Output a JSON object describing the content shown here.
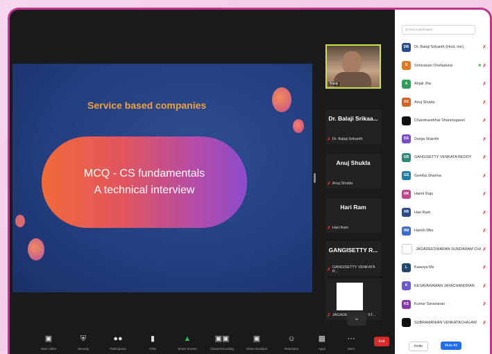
{
  "slide": {
    "title": "Service based companies",
    "line1": "MCQ - CS fundamentals",
    "line2": "A technical interview"
  },
  "thumbnails": [
    {
      "name": "Dr. Balaji Srikaa...",
      "sub": "Dr. Balaji Srikanth"
    },
    {
      "name": "Anuj Shukla",
      "sub": "Anuj Shukla"
    },
    {
      "name": "Hari Ram",
      "sub": "Hari Ram"
    },
    {
      "name": "GANGISETTY R...",
      "sub": "GANGISETTY VENKATA R..."
    },
    {
      "name": "",
      "sub": "JAGADEESWARAN ST..."
    }
  ],
  "video_label": "Balaji",
  "toolbar": {
    "items": [
      {
        "label": "Start Video",
        "icon": "video-off-icon"
      },
      {
        "label": "Security",
        "icon": "shield-icon"
      },
      {
        "label": "Participants",
        "icon": "participants-icon"
      },
      {
        "label": "Chat",
        "icon": "chat-icon"
      },
      {
        "label": "Share Screen",
        "icon": "share-screen-icon"
      },
      {
        "label": "Cloud Recording",
        "icon": "record-icon"
      },
      {
        "label": "Share Duration",
        "icon": "timer-icon"
      },
      {
        "label": "Reactions",
        "icon": "reactions-icon"
      },
      {
        "label": "Apps",
        "icon": "apps-icon"
      },
      {
        "label": "More",
        "icon": "more-icon"
      }
    ],
    "end_label": "End"
  },
  "panel": {
    "search_placeholder": "Q Find a participant",
    "participants": [
      {
        "initials": "DB",
        "name": "Dr. Balaji Srikanth (Host, me)",
        "color": "#2b4a8e"
      },
      {
        "initials": "S",
        "name": "Srinivasan Chelladurai",
        "color": "#e07a1e"
      },
      {
        "initials": "A",
        "name": "Anjali Jha",
        "color": "#2e9e5b"
      },
      {
        "initials": "AS",
        "name": "Anuj Shukla",
        "color": "#d0641e"
      },
      {
        "initials": "",
        "name": "Chandrasekhar Shanmugavel",
        "color": "#111111"
      },
      {
        "initials": "DS",
        "name": "Durga Shanthi",
        "color": "#7a4ec2"
      },
      {
        "initials": "GR",
        "name": "GANGISETTY VENKATA REDDY",
        "color": "#2a8a7a"
      },
      {
        "initials": "GS",
        "name": "Geetha Sharma",
        "color": "#1f7fa8"
      },
      {
        "initials": "HR",
        "name": "Harini Raju",
        "color": "#c2448a"
      },
      {
        "initials": "HR",
        "name": "Hari Ram",
        "color": "#2b4a8e"
      },
      {
        "initials": "HM",
        "name": "Harish Mits",
        "color": "#3a6bd4"
      },
      {
        "initials": "",
        "name": "JAGADEESWARAN SUNDARAM CHARIAR",
        "color": "#ffffff"
      },
      {
        "initials": "L",
        "name": "Kaaviya Ms",
        "color": "#1f4a6e"
      },
      {
        "initials": "K",
        "name": "KESAVARAMAN JAYACHANDRAN",
        "color": "#6a5acd"
      },
      {
        "initials": "KS",
        "name": "Kumar Saravanan",
        "color": "#8a3aa8"
      },
      {
        "initials": "",
        "name": "SUBRAMANIAN VENKATACHALAM",
        "color": "#111111"
      }
    ],
    "invite_label": "Invite",
    "mute_all_label": "Mute All"
  }
}
